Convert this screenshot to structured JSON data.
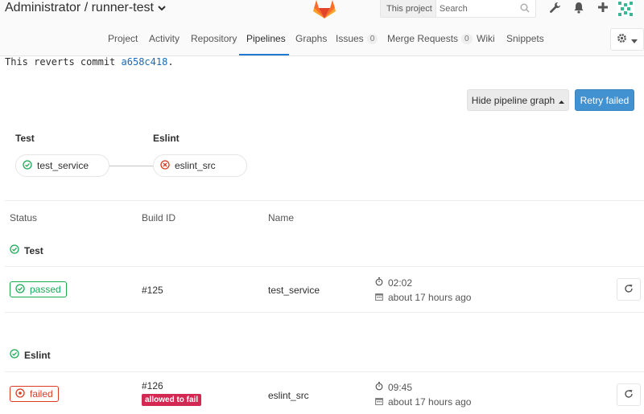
{
  "header": {
    "title": "Administrator / runner-test",
    "search": {
      "scope": "This project",
      "placeholder": "Search"
    }
  },
  "nav": {
    "items": [
      {
        "label": "Project"
      },
      {
        "label": "Activity"
      },
      {
        "label": "Repository"
      },
      {
        "label": "Pipelines",
        "active": true
      },
      {
        "label": "Graphs"
      },
      {
        "label": "Issues",
        "count": "0"
      },
      {
        "label": "Merge Requests",
        "count": "0"
      },
      {
        "label": "Wiki"
      },
      {
        "label": "Snippets"
      }
    ]
  },
  "commit": {
    "prefix": "This reverts commit",
    "sha": "a658c418",
    "suffix": "."
  },
  "actions": {
    "hide_graph": "Hide pipeline graph",
    "retry_failed": "Retry failed"
  },
  "graph": {
    "stages": [
      {
        "title": "Test",
        "job": "test_service",
        "status": "passed"
      },
      {
        "title": "Eslint",
        "job": "eslint_src",
        "status": "failed"
      }
    ]
  },
  "table": {
    "headers": {
      "status": "Status",
      "build_id": "Build ID",
      "name": "Name"
    },
    "groups": [
      {
        "title": "Test",
        "rows": [
          {
            "status": "passed",
            "build_id": "#125",
            "name": "test_service",
            "duration": "02:02",
            "finished": "about 17 hours ago"
          }
        ]
      },
      {
        "title": "Eslint",
        "rows": [
          {
            "status": "failed",
            "build_id": "#126",
            "tag": "allowed to fail",
            "name": "eslint_src",
            "duration": "09:45",
            "finished": "about 17 hours ago"
          }
        ]
      }
    ]
  },
  "colors": {
    "success": "#1aaa55",
    "failed": "#db3b21",
    "primary": "#4291d0",
    "tag": "#d22852"
  },
  "icons": [
    "wrench-icon",
    "bell-icon",
    "plus-icon",
    "avatar-identicon",
    "gear-icon",
    "search-icon",
    "timer-icon",
    "calendar-icon",
    "retry-icon",
    "check-circle-icon",
    "close-circle-icon"
  ]
}
